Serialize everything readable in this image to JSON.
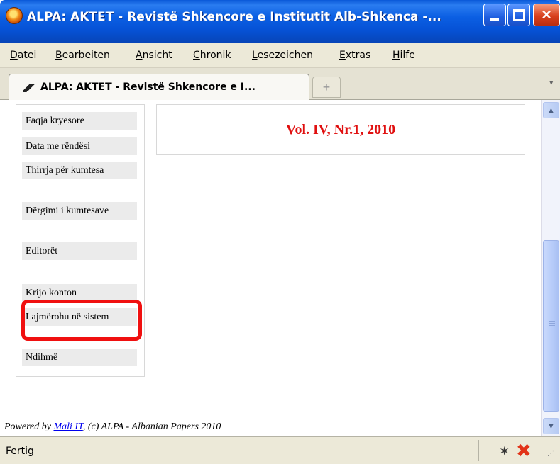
{
  "window": {
    "title": "ALPA: AKTET - Revistë Shkencore e Institutit Alb-Shkenca -..."
  },
  "menu": [
    {
      "first": "D",
      "rest": "atei"
    },
    {
      "first": "B",
      "rest": "earbeiten"
    },
    {
      "first": "A",
      "rest": "nsicht"
    },
    {
      "first": "C",
      "rest": "hronik"
    },
    {
      "first": "L",
      "rest": "esezeichen"
    },
    {
      "first": "E",
      "rest": "xtras"
    },
    {
      "first": "H",
      "rest": "ilfe"
    }
  ],
  "tab": {
    "label": "ALPA: AKTET - Revistë Shkencore e I...",
    "new_tab_symbol": "+"
  },
  "sidebar": {
    "items": [
      {
        "label": "Faqja kryesore"
      },
      {
        "label": "Data me rëndësi"
      },
      {
        "label": "Thirrja për kumtesa"
      },
      {
        "label": "Dërgimi i kumtesave"
      },
      {
        "label": "Editorët"
      },
      {
        "label": "Krijo konton"
      },
      {
        "label": "Lajmërohu në sistem"
      },
      {
        "label": "Ndihmë"
      }
    ],
    "highlight_color": "#f01010"
  },
  "main": {
    "heading": "Vol. IV, Nr.1, 2010",
    "heading_color": "#e01010"
  },
  "footer": {
    "prefix": "Powered by ",
    "link_text": "Mali IT",
    "suffix": ", (c) ALPA - Albanian Papers 2010"
  },
  "status": {
    "text": "Fertig"
  },
  "icons": {
    "app": "firefox-icon",
    "tab": "site-favicon",
    "status_1": "bug-icon",
    "status_2": "blocked-icon"
  }
}
